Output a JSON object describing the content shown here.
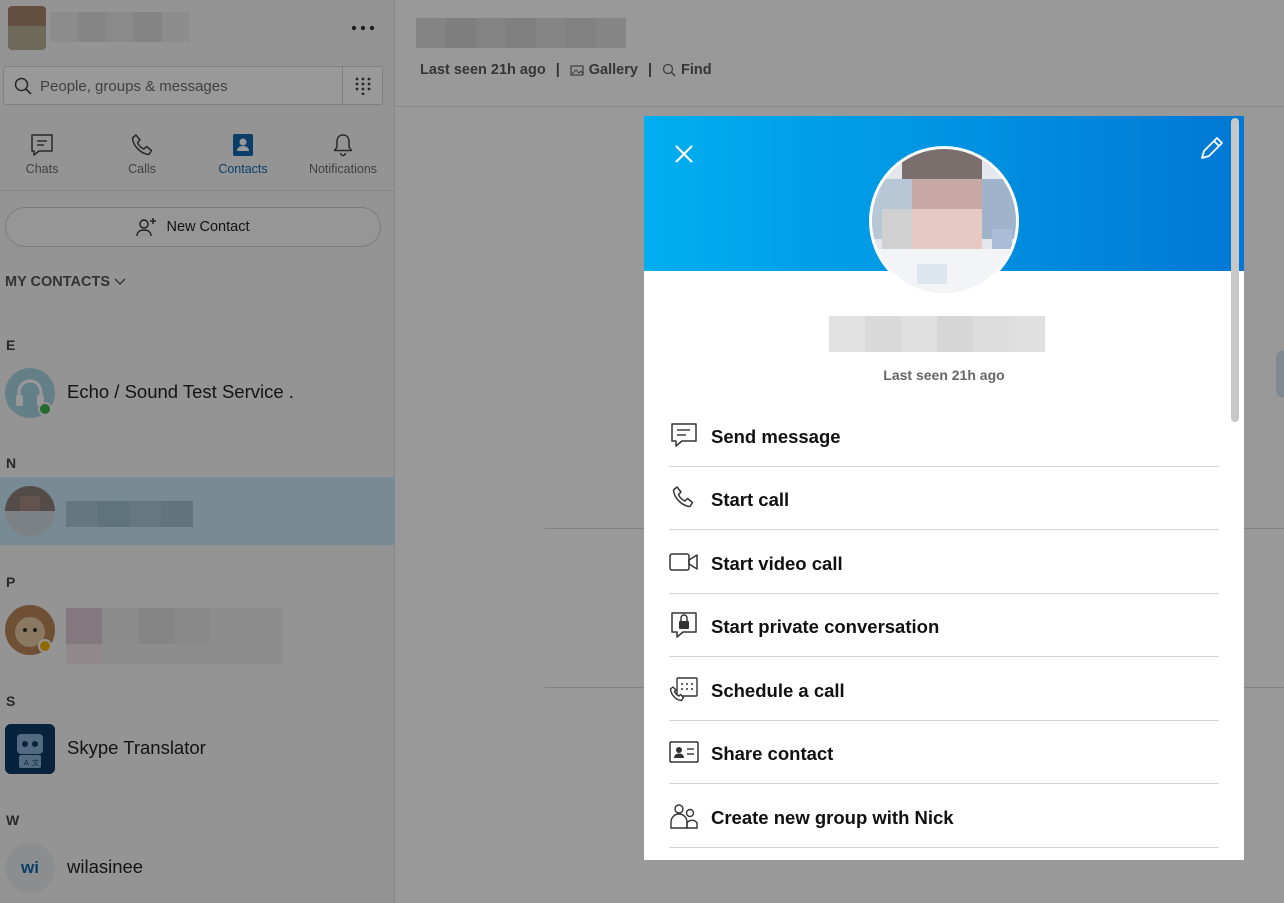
{
  "search": {
    "placeholder": "People, groups & messages"
  },
  "nav_tabs": [
    {
      "label": "Chats",
      "icon": "chat-icon"
    },
    {
      "label": "Calls",
      "icon": "phone-icon"
    },
    {
      "label": "Contacts",
      "icon": "contacts-book-icon",
      "active": true
    },
    {
      "label": "Notifications",
      "icon": "bell-icon"
    }
  ],
  "new_contact_label": "New Contact",
  "my_contacts_label": "MY CONTACTS",
  "groups": [
    {
      "letter": "E"
    },
    {
      "letter": "N"
    },
    {
      "letter": "P"
    },
    {
      "letter": "S"
    },
    {
      "letter": "W"
    }
  ],
  "contacts": {
    "echo": {
      "name": "Echo / Sound Test Service ."
    },
    "translator": {
      "name": "Skype Translator"
    },
    "wilasinee": {
      "name": "wilasinee",
      "initials": "wi"
    }
  },
  "chat_header": {
    "last_seen": "Last seen 21h ago",
    "separator": "|",
    "gallery": "Gallery",
    "find": "Find"
  },
  "profile_card": {
    "last_seen": "Last seen 21h ago",
    "actions": [
      {
        "label": "Send message",
        "icon": "message-icon"
      },
      {
        "label": "Start call",
        "icon": "phone-icon"
      },
      {
        "label": "Start video call",
        "icon": "video-camera-icon"
      },
      {
        "label": "Start private conversation",
        "icon": "lock-icon"
      },
      {
        "label": "Schedule a call",
        "icon": "calendar-phone-icon"
      },
      {
        "label": "Share contact",
        "icon": "contact-card-icon"
      },
      {
        "label": "Create new group with Nick",
        "icon": "group-icon"
      }
    ]
  },
  "colors": {
    "accent": "#0078d4",
    "banner_start": "#00aff0",
    "online": "#3db34a",
    "away": "#f2b100",
    "selected_row": "#c8e7f5"
  }
}
